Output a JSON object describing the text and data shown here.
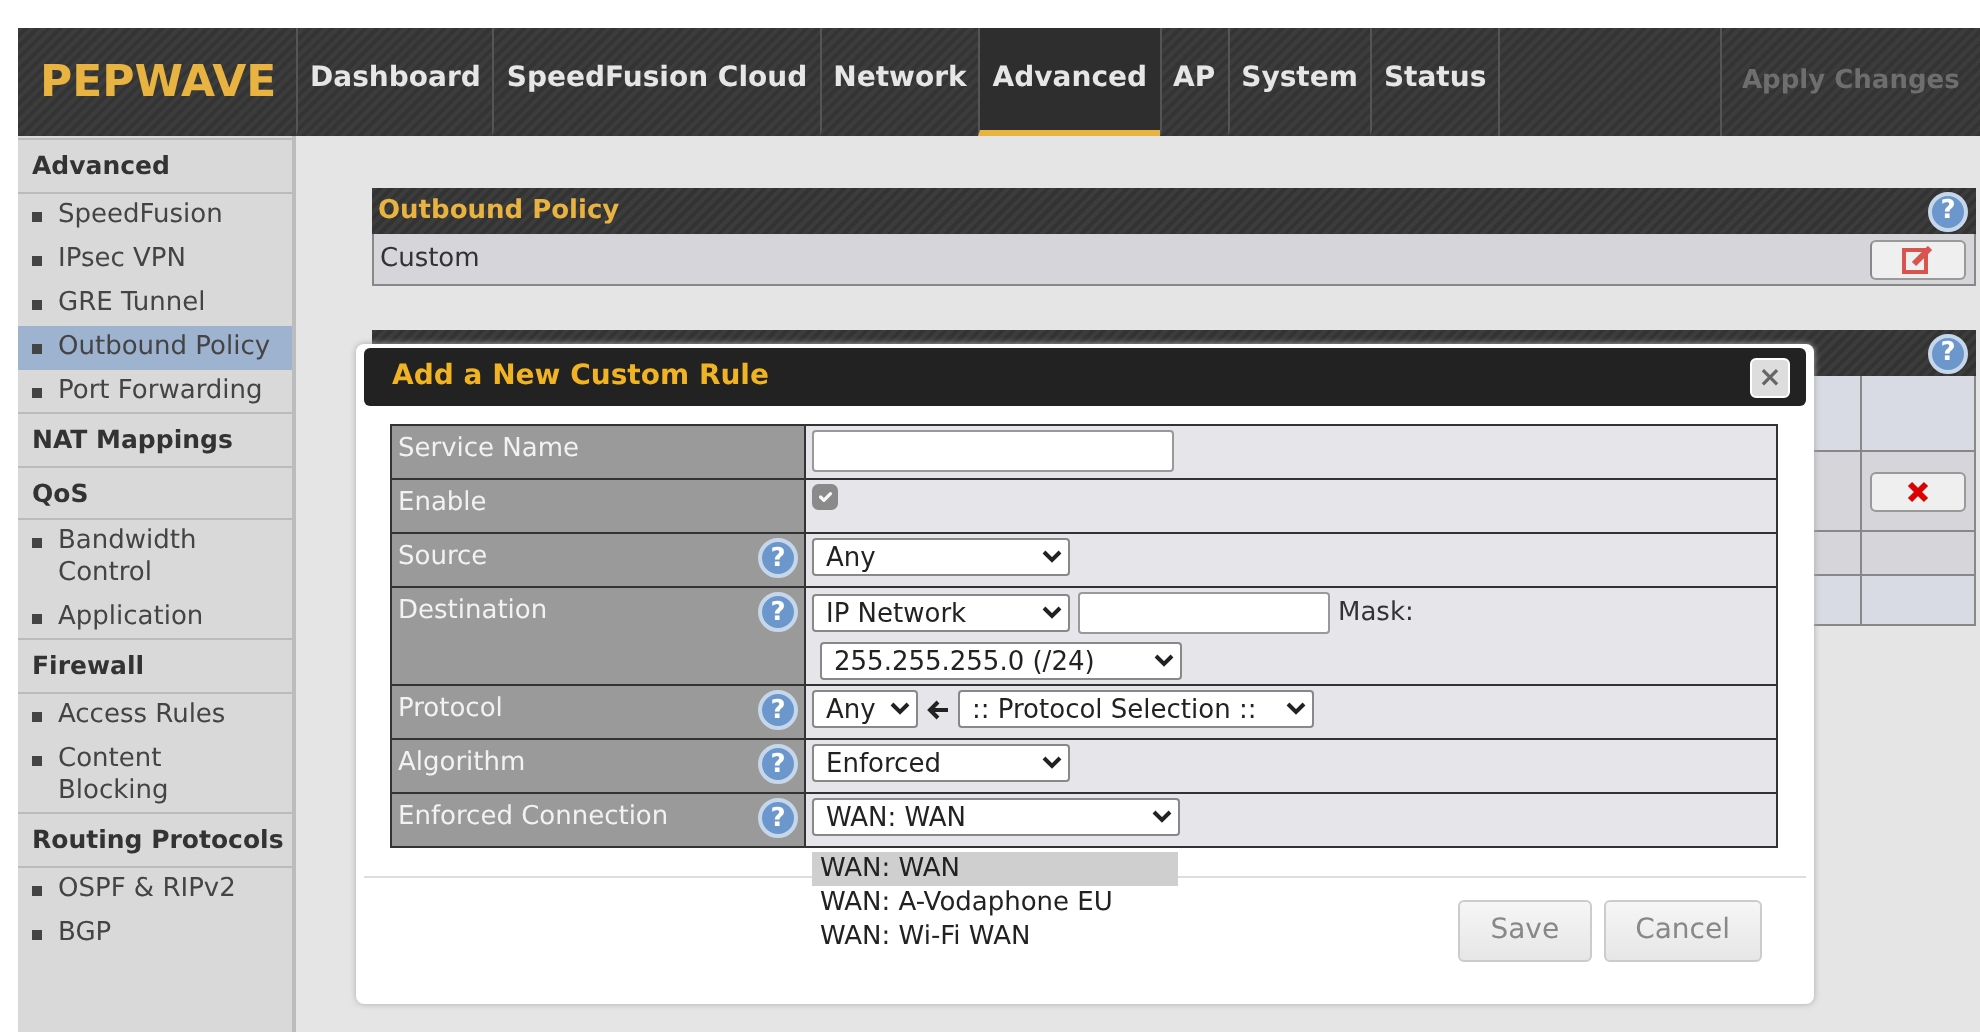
{
  "header": {
    "logo": "PEPWAVE",
    "nav": [
      {
        "label": "Dashboard",
        "selected": false
      },
      {
        "label": "SpeedFusion Cloud",
        "selected": false
      },
      {
        "label": "Network",
        "selected": false
      },
      {
        "label": "Advanced",
        "selected": true
      },
      {
        "label": "AP",
        "selected": false
      },
      {
        "label": "System",
        "selected": false
      },
      {
        "label": "Status",
        "selected": false
      }
    ],
    "apply": {
      "label": "Apply Changes",
      "disabled": true
    }
  },
  "sidebar": {
    "groups": [
      {
        "title": "Advanced",
        "items": [
          {
            "label": "SpeedFusion",
            "selected": false
          },
          {
            "label": "IPsec VPN",
            "selected": false
          },
          {
            "label": "GRE Tunnel",
            "selected": false
          },
          {
            "label": "Outbound Policy",
            "selected": true
          },
          {
            "label": "Port Forwarding",
            "selected": false
          }
        ]
      },
      {
        "title": "NAT Mappings"
      },
      {
        "title": "QoS",
        "items": [
          {
            "label": "Bandwidth Control",
            "selected": false
          },
          {
            "label": "Application",
            "selected": false
          }
        ]
      },
      {
        "title": "Firewall",
        "items": [
          {
            "label": "Access Rules",
            "selected": false
          },
          {
            "label": "Content Blocking",
            "selected": false
          }
        ]
      },
      {
        "title": "Routing Protocols",
        "items": [
          {
            "label": "OSPF & RIPv2",
            "selected": false
          },
          {
            "label": "BGP",
            "selected": false
          }
        ]
      }
    ]
  },
  "outbound_panel": {
    "title": "Outbound Policy",
    "help": "?",
    "value": "Custom"
  },
  "rules_panel": {
    "help": "?"
  },
  "modal": {
    "title": "Add a New Custom Rule",
    "close": "×",
    "fields": [
      {
        "kind": "text",
        "label": "Service Name"
      },
      {
        "kind": "checkbox",
        "label": "Enable",
        "checked": true
      },
      {
        "kind": "select",
        "label": "Source",
        "help": "?",
        "value": "Any"
      },
      {
        "kind": "destination",
        "label": "Destination",
        "help": "?",
        "value": "IP Network",
        "mask_label": "Mask:",
        "mask_value": "255.255.255.0 (/24)"
      },
      {
        "kind": "protocol",
        "label": "Protocol",
        "help": "?",
        "value": "Any",
        "selection": ":: Protocol Selection ::"
      },
      {
        "kind": "select",
        "label": "Algorithm",
        "help": "?",
        "value": "Enforced"
      },
      {
        "kind": "select",
        "label": "Enforced Connection",
        "help": "?",
        "value": "WAN: WAN",
        "options": [
          {
            "label": "WAN: WAN",
            "selected": true
          },
          {
            "label": "WAN: A-Vodaphone EU",
            "selected": false
          },
          {
            "label": "WAN: Wi-Fi WAN",
            "selected": false
          }
        ]
      }
    ],
    "buttons": [
      "Save",
      "Cancel"
    ]
  }
}
